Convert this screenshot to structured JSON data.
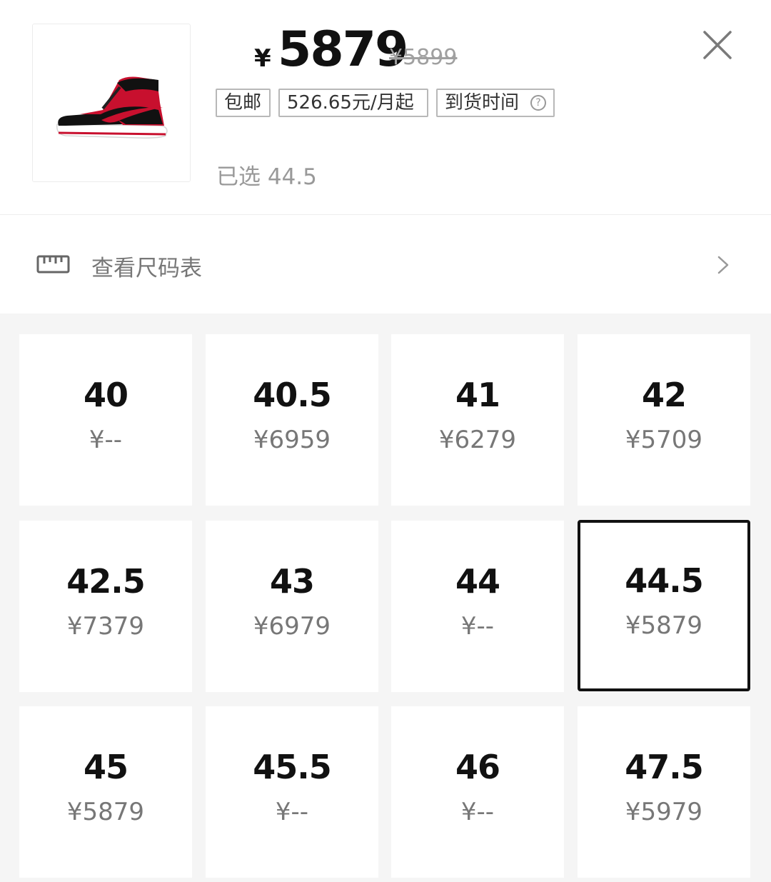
{
  "product": {
    "thumbnail_icon": "sneaker-image",
    "currency_symbol": "¥",
    "price": "5879",
    "original_price": "¥5899",
    "tags": [
      {
        "label": "包邮"
      },
      {
        "label": "526.65元/月起"
      },
      {
        "label": "到货时间"
      }
    ],
    "help_icon_glyph": "?",
    "selected_text": "已选 44.5"
  },
  "size_chart": {
    "icon": "ruler-icon",
    "label": "查看尺码表",
    "chevron_icon": "chevron-right-icon"
  },
  "close_icon": "close-icon",
  "sizes": [
    {
      "size": "40",
      "price": "¥--"
    },
    {
      "size": "40.5",
      "price": "¥6959"
    },
    {
      "size": "41",
      "price": "¥6279"
    },
    {
      "size": "42",
      "price": "¥5709"
    },
    {
      "size": "42.5",
      "price": "¥7379"
    },
    {
      "size": "43",
      "price": "¥6979"
    },
    {
      "size": "44",
      "price": "¥--"
    },
    {
      "size": "44.5",
      "price": "¥5879",
      "selected": true
    },
    {
      "size": "45",
      "price": "¥5879"
    },
    {
      "size": "45.5",
      "price": "¥--"
    },
    {
      "size": "46",
      "price": "¥--"
    },
    {
      "size": "47.5",
      "price": "¥5979"
    }
  ],
  "colors": {
    "text": "#111111",
    "muted": "#999999",
    "price_muted": "#777777",
    "grid_background": "#f5f5f5",
    "selected_border": "#111111",
    "shoe_red": "#c8102e"
  }
}
